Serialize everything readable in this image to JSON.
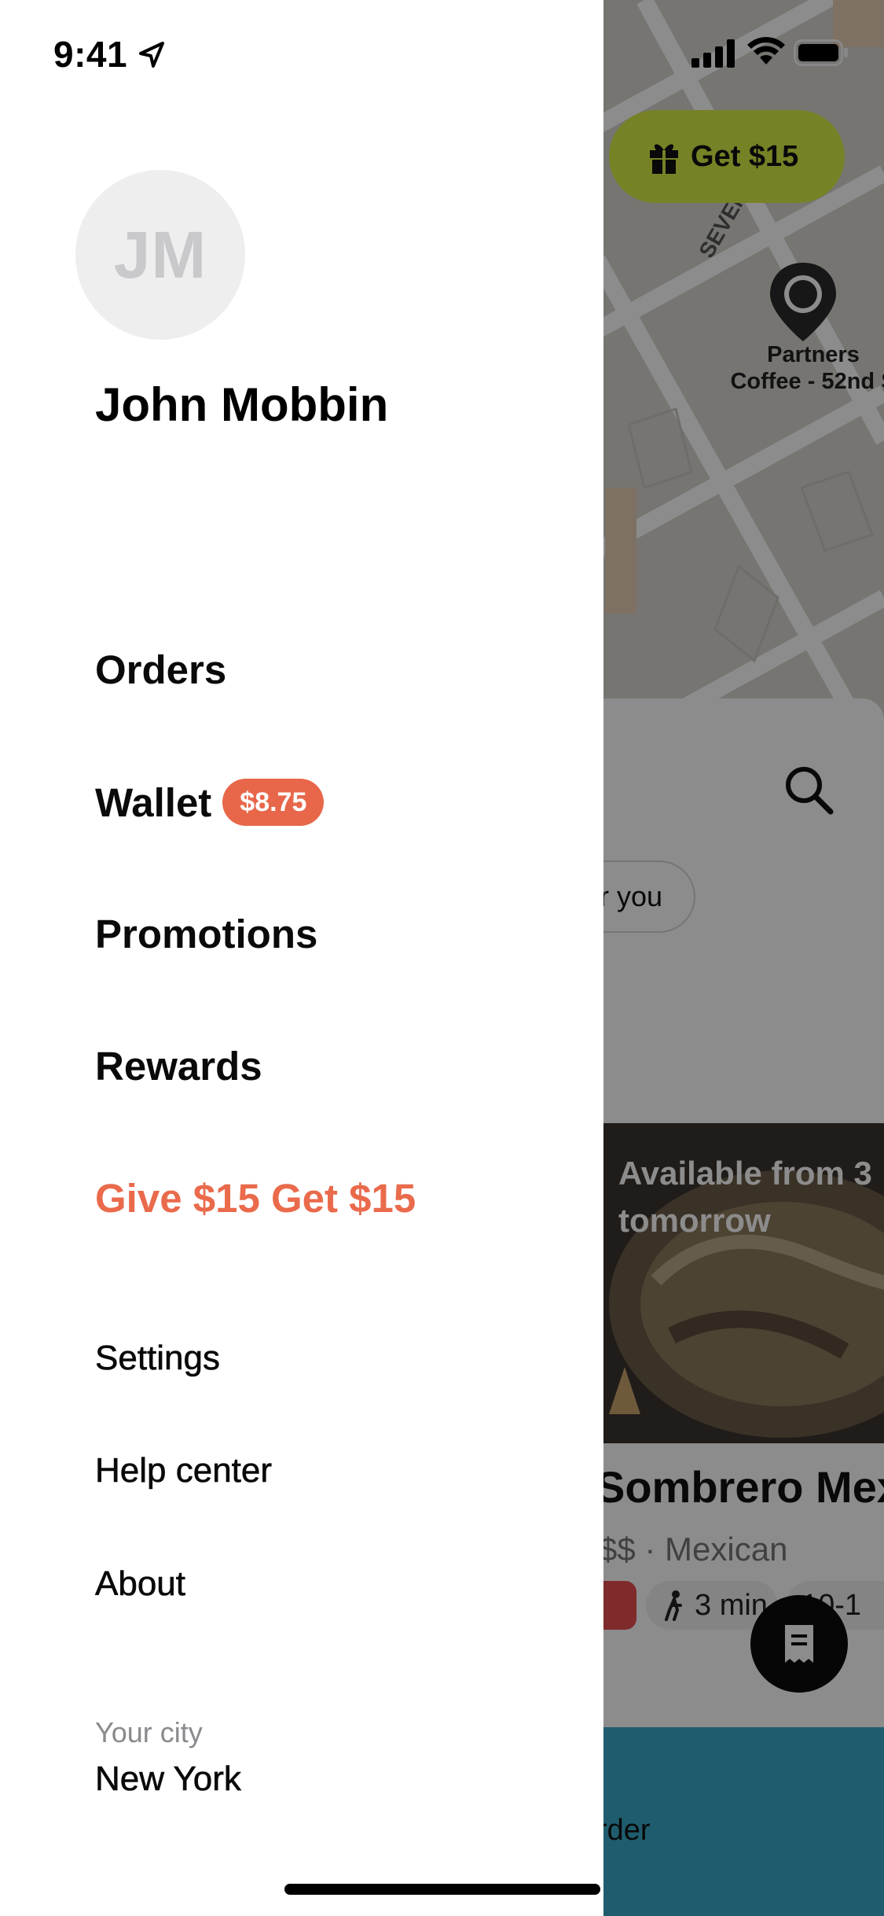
{
  "status_bar": {
    "time": "9:41"
  },
  "user": {
    "initials": "JM",
    "name": "John Mobbin"
  },
  "menu": {
    "orders": "Orders",
    "wallet": "Wallet",
    "wallet_balance": "$8.75",
    "promotions": "Promotions",
    "rewards": "Rewards",
    "referral": "Give $15 Get $15"
  },
  "secondary_menu": {
    "settings": "Settings",
    "help": "Help center",
    "about": "About"
  },
  "city": {
    "label": "Your city",
    "value": "New York"
  },
  "background": {
    "get_button": "Get $15",
    "pin_label_line1": "Partners",
    "pin_label_line2": "Coffee - 52nd S",
    "chip_text": "r you",
    "promo_text": "Available from 3 tomorrow",
    "restaurant_name": "Sombrero Mex",
    "restaurant_sub": "$$ · Mexican",
    "walk_time": "3 min",
    "time_pill": "10-1",
    "order_text": "rder"
  },
  "colors": {
    "accent": "#ea6a4c",
    "wallet_badge": "#e8674a",
    "avatar_bg": "#eeeeef",
    "get_button_bg": "#d9eb45"
  },
  "icons": [
    "location-arrow-icon",
    "signal-icon",
    "wifi-icon",
    "battery-icon",
    "gift-icon",
    "map-pin-icon",
    "search-icon",
    "walk-icon",
    "receipt-icon"
  ]
}
